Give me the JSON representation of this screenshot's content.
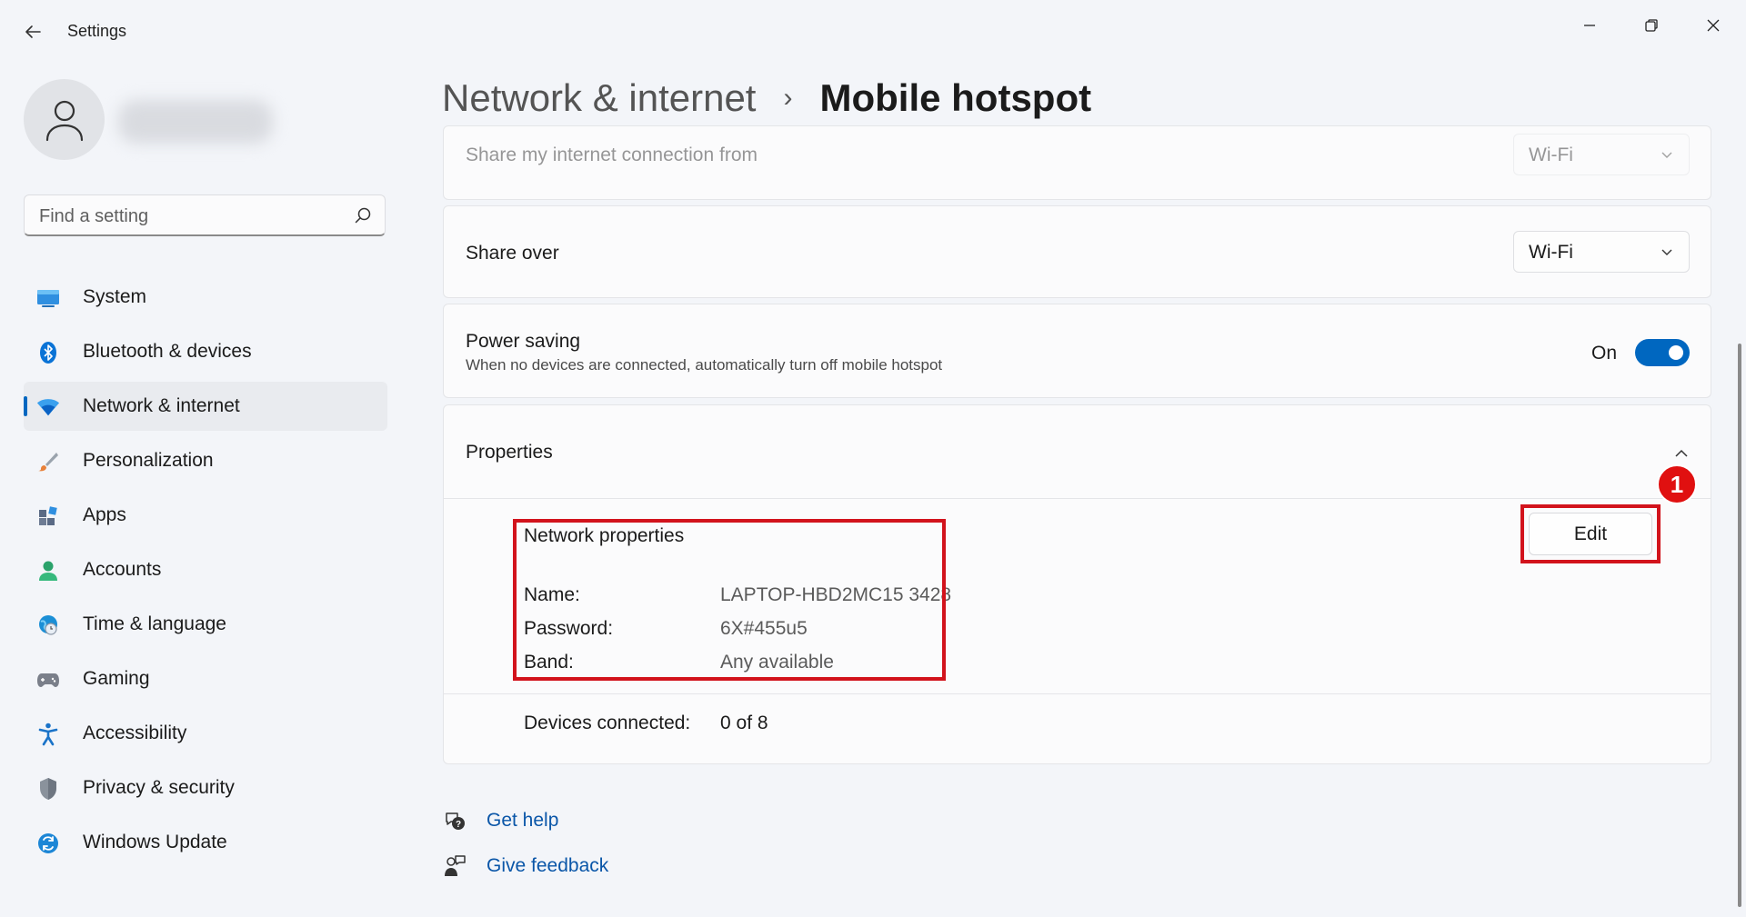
{
  "window": {
    "title": "Settings",
    "controls": [
      "minimize",
      "maximize",
      "close"
    ]
  },
  "sidebar": {
    "search_placeholder": "Find a setting",
    "items": [
      {
        "label": "System",
        "icon": "display-icon",
        "color": "#0078d4"
      },
      {
        "label": "Bluetooth & devices",
        "icon": "bluetooth-icon",
        "color": "#0078d4"
      },
      {
        "label": "Network & internet",
        "icon": "wifi-icon",
        "color": "#0067c0",
        "active": true
      },
      {
        "label": "Personalization",
        "icon": "brush-icon",
        "color": "#e07b3c"
      },
      {
        "label": "Apps",
        "icon": "apps-icon",
        "color": "#5a6a85"
      },
      {
        "label": "Accounts",
        "icon": "person-icon",
        "color": "#2aa26b"
      },
      {
        "label": "Time & language",
        "icon": "globe-clock-icon",
        "color": "#1b8fd6"
      },
      {
        "label": "Gaming",
        "icon": "gamepad-icon",
        "color": "#7a7f8a"
      },
      {
        "label": "Accessibility",
        "icon": "accessibility-icon",
        "color": "#1a73c8"
      },
      {
        "label": "Privacy & security",
        "icon": "shield-icon",
        "color": "#6e7681"
      },
      {
        "label": "Windows Update",
        "icon": "update-icon",
        "color": "#1c86d6"
      }
    ]
  },
  "header": {
    "parent": "Network & internet",
    "separator": "›",
    "current": "Mobile hotspot"
  },
  "settings": {
    "share_connection": {
      "label": "Share my internet connection from",
      "value": "Wi-Fi"
    },
    "share_over": {
      "label": "Share over",
      "value": "Wi-Fi"
    },
    "power_saving": {
      "label": "Power saving",
      "description": "When no devices are connected, automatically turn off mobile hotspot",
      "state": "On",
      "enabled": true
    },
    "properties": {
      "label": "Properties",
      "section_title": "Network properties",
      "edit_label": "Edit",
      "rows": [
        {
          "key": "Name:",
          "value": "LAPTOP-HBD2MC15 3428"
        },
        {
          "key": "Password:",
          "value": "6X#455u5"
        },
        {
          "key": "Band:",
          "value": "Any available"
        }
      ],
      "devices_label": "Devices connected:",
      "devices_value": "0 of 8"
    }
  },
  "annotation": {
    "step": "1",
    "color": "#d2131c"
  },
  "links": {
    "help": "Get help",
    "feedback": "Give feedback"
  },
  "accent": "#0067c0"
}
